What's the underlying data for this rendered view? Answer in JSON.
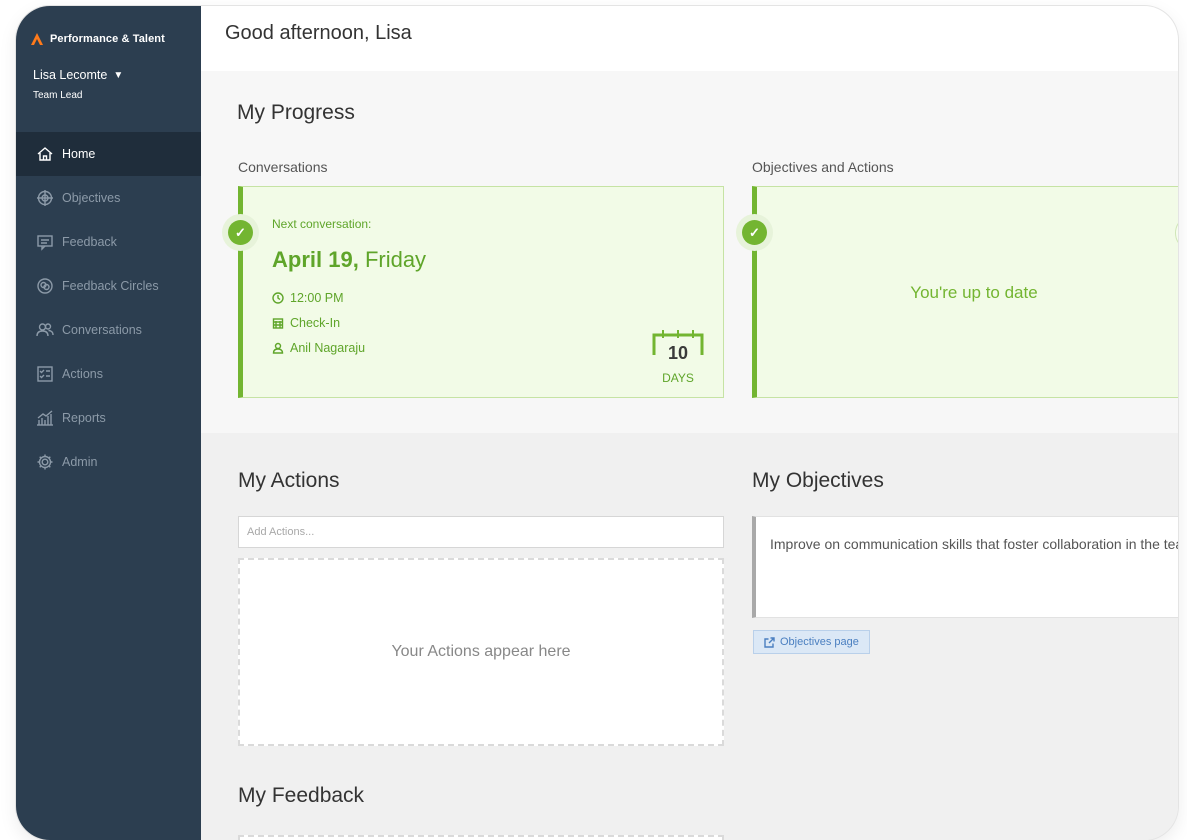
{
  "colors": {
    "sidebar": "#2c3e50",
    "accent_green": "#73b531",
    "link_blue": "#4a7fc0"
  },
  "brand": {
    "name": "Performance & Talent",
    "logo_icon": "chevron-logo"
  },
  "user": {
    "name": "Lisa Lecomte",
    "role": "Team Lead"
  },
  "nav": [
    {
      "label": "Home",
      "icon": "home-icon",
      "active": true
    },
    {
      "label": "Objectives",
      "icon": "target-icon"
    },
    {
      "label": "Feedback",
      "icon": "feedback-icon"
    },
    {
      "label": "Feedback Circles",
      "icon": "feedback-circles-icon"
    },
    {
      "label": "Conversations",
      "icon": "conversations-icon"
    },
    {
      "label": "Actions",
      "icon": "actions-icon"
    },
    {
      "label": "Reports",
      "icon": "reports-icon"
    },
    {
      "label": "Admin",
      "icon": "gear-icon"
    }
  ],
  "greeting": "Good afternoon, Lisa",
  "progress": {
    "title": "My Progress",
    "conversations": {
      "title": "Conversations",
      "next_label": "Next conversation:",
      "date": "April 19,",
      "day": "Friday",
      "time": "12:00 PM",
      "type": "Check-In",
      "person": "Anil Nagaraju",
      "days_count": "10",
      "days_label": "DAYS"
    },
    "objectives": {
      "title": "Objectives and Actions",
      "status": "You're up to date"
    }
  },
  "actions": {
    "title": "My Actions",
    "placeholder": "Add Actions...",
    "empty_text": "Your Actions appear here"
  },
  "objectives_list": {
    "title": "My Objectives",
    "item": "Improve on communication skills that foster collaboration in the team.",
    "link_label": "Objectives page"
  },
  "feedback": {
    "title": "My Feedback"
  }
}
